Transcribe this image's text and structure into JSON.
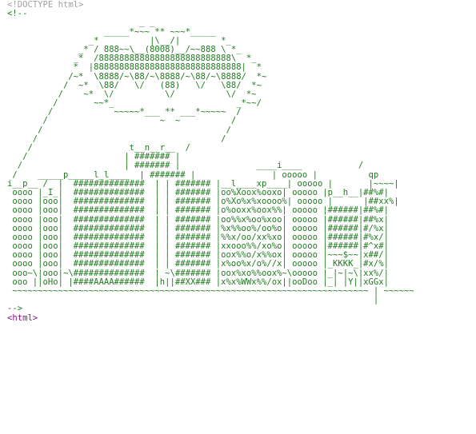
{
  "source": {
    "doctype_line": "<!DOCTYPE html>",
    "comment_open": "<!--",
    "art_lines": [
      "                          _ _",
      "                   _____*~~~ ** ~~~*_____",
      "                _*          |\\__/|        *_",
      "              _* / 888~~\\__(8008)__/~~888 \\ *_",
      "             _*  /88888888888888888888888888\\  *_",
      "             *  |88888888888888888888888888888|  *",
      "            /~*  \\8888/~\\88/~\\8888/~\\88/~\\8888/  *~",
      "           /  ~*  \\88/   \\/   (88)   \\/   \\88/  *~",
      "          /    ~*  \\/          \\/          \\/  *~",
      "         /       ~~*_                        _*~~/",
      "        /            ~~~~~*___ ** ___*~~~~~  /",
      "       /                      ~  ~          /",
      "      /                                    /",
      "     /                                    /",
      "    /                   t__n__r__  /",
      "   /                   | ####### |",
      "  /                    | ####### |               ____i____           /",
      " /    _____p_____l_l____  | ####### |               | ooooo |          qp",
      "i__p__ /  |  ##############  | | ####### |__l____xp____| ooooo |       |~~~~|",
      " oooo |_I_|  ##############  | | ####### |oo%Xoox%ooxo| ooooo |p__h__|##%#|",
      " oooo |ooo|  ##############  | | ####### |o%Xo%x%xoooo%| ooooo |      |##xx%|",
      " oooo |ooo|  ##############  | | ####### |o%ooxx%oox%%| ooooo |######|##%#|",
      " oooo |ooo|  ##############  | | ####### |oo%%x%oo%xoo| ooooo |######|##%x|",
      " oooo |ooo|  ##############  | | ####### |%x%%oo%/oo%o| ooooo |######|#/%x|",
      " oooo |ooo|  ##############  | | ####### |%%x/oo/xx%xo| ooooo |######|#%x/|",
      " oooo |ooo|  ##############  | | ####### |xxooo%%/xo%o| ooooo |######|#^x#|",
      " oooo |ooo|  ##############  | | ####### |oox%%o/x%%ox| ooooo |~~~$~~|x##/|",
      " oooo |ooo|  ##############  | | ####### |x%oo%x/o%//x| ooooo |_KKKK_|#x/%|",
      " ooo~\\|ooo|~\\##############  | ~\\####### |oox%xo%%oox%~\\ooooo |_|~|~\\|xx%/|",
      " ooo ||oHo| |####AAAA######  |h||##XX### |x%x%WWx%%/ox||ooDoo |_| |Y||xGGx|",
      " ~~~~~~~~~~~~~~~~~~~~~~~~~~~~~~~~~~~~~~~~~~~~~~~~~~~~~~~~~~~~~~~~~~~~~~ | ~~~~~~",
      "                                                                        |"
    ],
    "comment_close": "-->",
    "html_open_tag": "<html>"
  },
  "colors": {
    "background": "#ffffff",
    "doctype": "#a0a0a0",
    "comment": "#1f7a1f",
    "tag": "#881280"
  }
}
